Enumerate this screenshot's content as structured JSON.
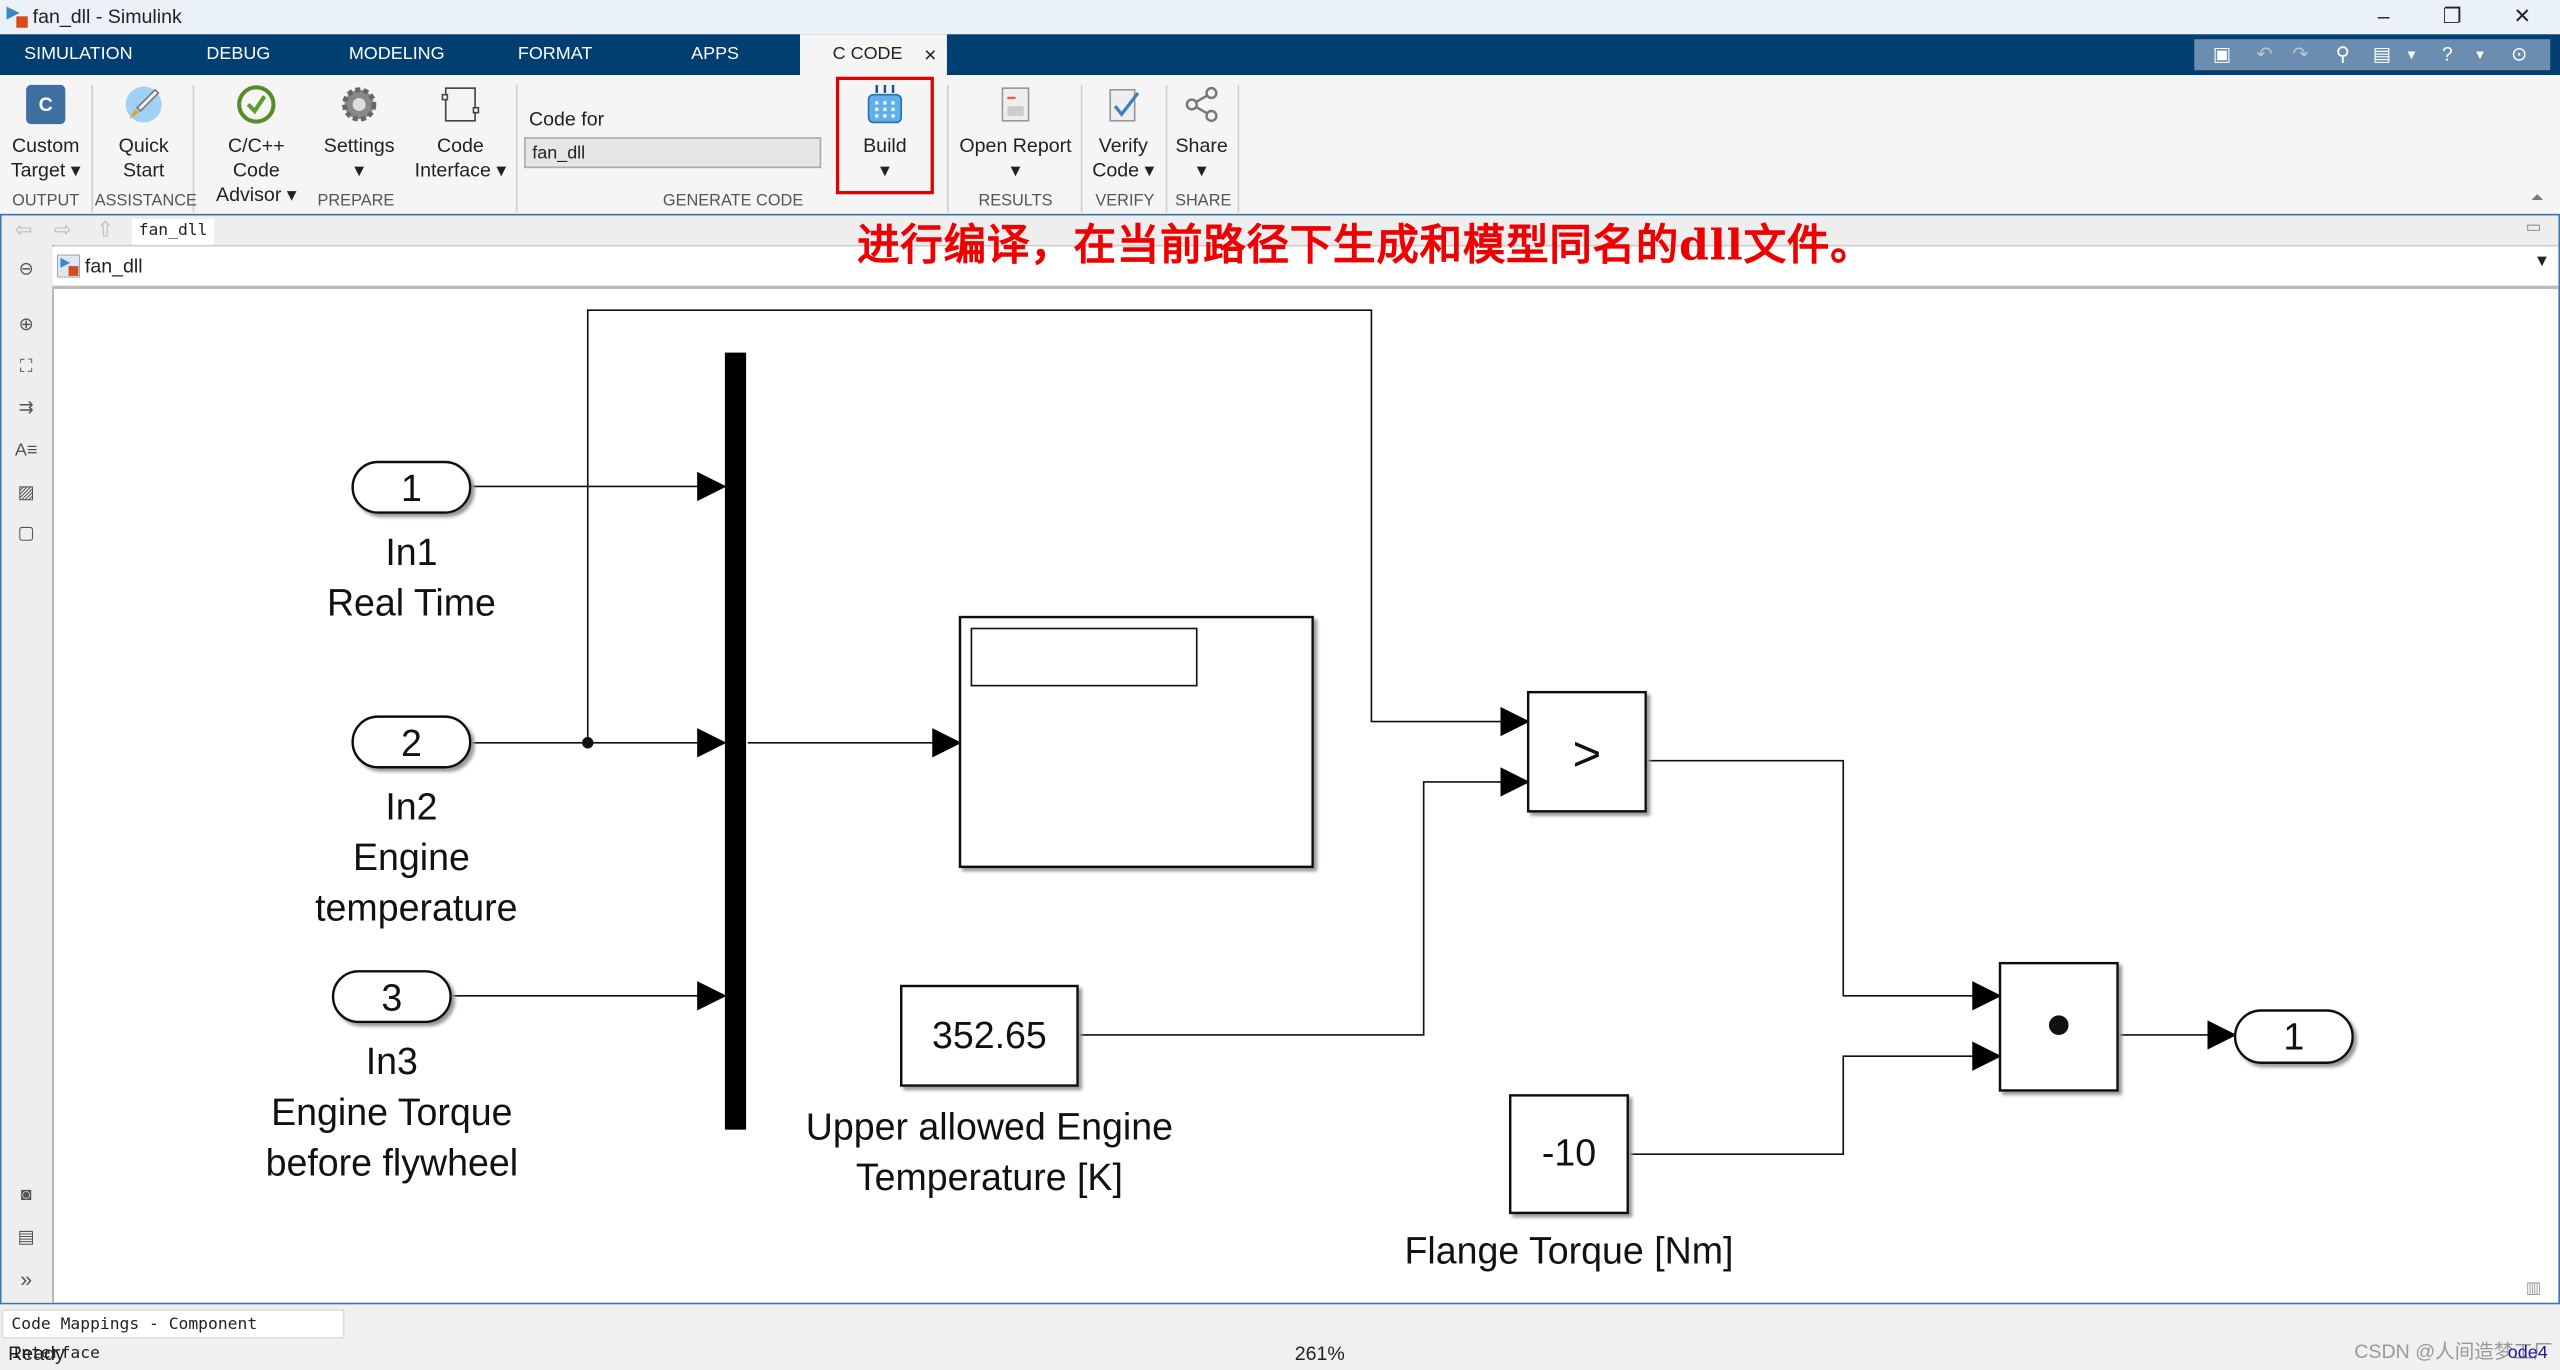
{
  "window": {
    "title": "fan_dll - Simulink",
    "minimize": "–",
    "restore": "❐",
    "close": "✕"
  },
  "tabs": [
    {
      "label": "SIMULATION"
    },
    {
      "label": "DEBUG"
    },
    {
      "label": "MODELING"
    },
    {
      "label": "FORMAT"
    },
    {
      "label": "APPS"
    },
    {
      "label": "C CODE",
      "active": true,
      "close": "×"
    }
  ],
  "quick_access": [
    "save-icon",
    "undo-icon",
    "redo-icon",
    "search-icon",
    "bookmark-icon",
    "help-icon",
    "expand-icon"
  ],
  "toolstrip": {
    "custom_target": {
      "line1": "Custom",
      "line2": "Target ▾"
    },
    "quick_start": {
      "line1": "Quick",
      "line2": "Start"
    },
    "code_advisor": {
      "line1": "C/C++ Code",
      "line2": "Advisor ▾"
    },
    "settings": {
      "line1": "Settings",
      "line2": "▾"
    },
    "code_interface": {
      "line1": "Code",
      "line2": "Interface ▾"
    },
    "code_for_label": "Code for",
    "code_for_value": "fan_dll",
    "build": {
      "line1": "Build",
      "line2": "▾"
    },
    "open_report": {
      "line1": "Open Report",
      "line2": "▾"
    },
    "verify_code": {
      "line1": "Verify",
      "line2": "Code ▾"
    },
    "share": {
      "line1": "Share",
      "line2": "▾"
    },
    "sections": {
      "output": "OUTPUT",
      "assistance": "ASSISTANCE",
      "prepare": "PREPARE",
      "generate_code": "GENERATE CODE",
      "results": "RESULTS",
      "verify": "VERIFY",
      "share": "SHARE"
    }
  },
  "editor": {
    "model_tab": "fan_dll",
    "breadcrumb": "fan_dll",
    "annotation": "进行编译，在当前路径下生成和模型同名的dll文件。"
  },
  "diagram": {
    "inports": [
      {
        "number": "1",
        "name": "In1",
        "desc1": "Real Time",
        "desc2": ""
      },
      {
        "number": "2",
        "name": "In2",
        "desc1": "Engine",
        "desc2": "temperature"
      },
      {
        "number": "3",
        "name": "In3",
        "desc1": "Engine Torque",
        "desc2": "before flywheel"
      }
    ],
    "constant_temp": {
      "value": "352.65",
      "label1": "Upper allowed Engine",
      "label2": "Temperature [K]"
    },
    "constant_torque": {
      "value": "-10",
      "label1": "Flange Torque [Nm]"
    },
    "relational_operator": ">",
    "product_symbol": "•",
    "outport": {
      "number": "1"
    }
  },
  "bottom": {
    "panel_tab": "Code Mappings - Component Interface",
    "status": "Ready",
    "zoom": "261%",
    "watermark": "CSDN @人间造梦工厂",
    "solver": "ode4"
  }
}
